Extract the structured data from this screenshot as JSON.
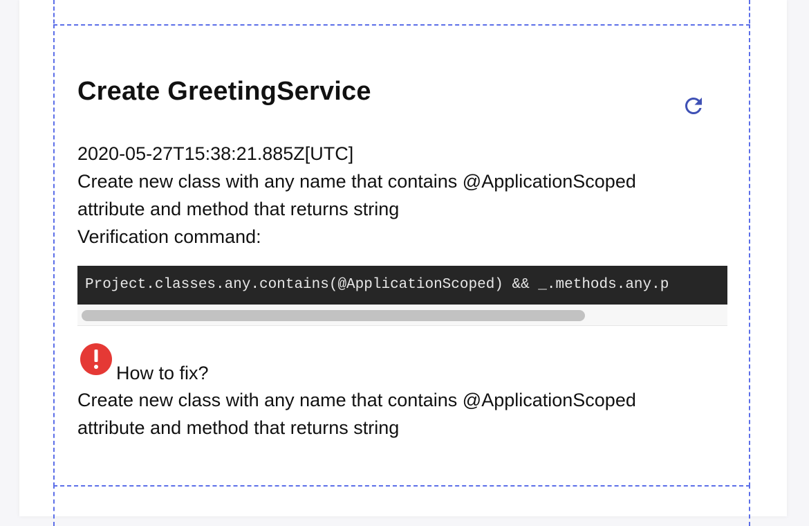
{
  "task": {
    "title": "Create GreetingService",
    "timestamp": "2020-05-27T15:38:21.885Z[UTC]",
    "description_lines": [
      "Create new class with any name that contains @ApplicationScoped",
      "attribute and method that returns string"
    ],
    "verification_label": "Verification command:",
    "verification_command": "Project.classes.any.contains(@ApplicationScoped) && _.methods.any.p",
    "refresh_icon": "refresh-icon"
  },
  "fix": {
    "icon": "error-icon",
    "label": "How to fix?",
    "lines": [
      "Create new class with any name that contains @ApplicationScoped",
      "attribute and method that returns string"
    ]
  },
  "colors": {
    "accent": "#3f51b5",
    "error": "#e53935",
    "dashed_border": "#5b6ee8",
    "code_bg": "#262626"
  }
}
